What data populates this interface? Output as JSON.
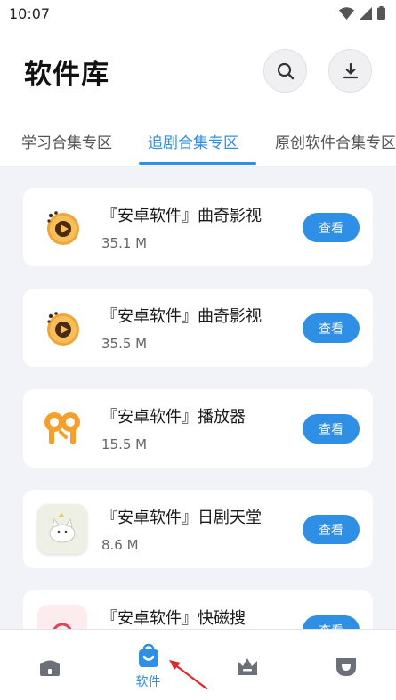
{
  "status": {
    "time": "10:07"
  },
  "header": {
    "title": "软件库"
  },
  "tabs": [
    {
      "label": "学习合集专区"
    },
    {
      "label": "追剧合集专区"
    },
    {
      "label": "原创软件合集专区"
    }
  ],
  "apps": [
    {
      "title": "『安卓软件』曲奇影视",
      "size": "35.1 M",
      "button": "查看"
    },
    {
      "title": "『安卓软件』曲奇影视",
      "size": "35.5 M",
      "button": "查看"
    },
    {
      "title": "『安卓软件』播放器",
      "size": "15.5 M",
      "button": "查看"
    },
    {
      "title": "『安卓软件』日剧天堂",
      "size": "8.6 M",
      "button": "查看"
    },
    {
      "title": "『安卓软件』快磁搜",
      "size": "",
      "button": "查看"
    }
  ],
  "bottom_nav": {
    "active_label": "软件"
  },
  "colors": {
    "accent": "#2f8fe4",
    "background": "#f1f3f8",
    "arrow": "#e0282b"
  },
  "icons": {
    "search": "search-icon",
    "download": "download-icon",
    "home": "home-icon",
    "software": "shopping-bag-icon",
    "crown": "crown-icon",
    "profile": "badge-icon"
  }
}
